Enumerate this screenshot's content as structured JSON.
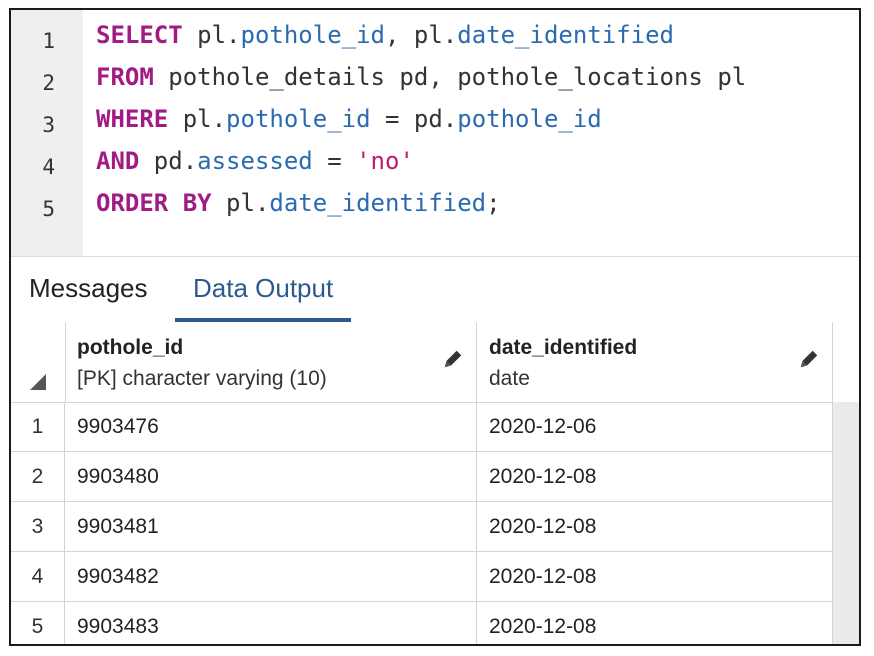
{
  "editor": {
    "line_numbers": [
      "1",
      "2",
      "3",
      "4",
      "5"
    ],
    "lines": [
      [
        "SELECT",
        " pl.",
        "pothole_id",
        ", pl.",
        "date_identified"
      ],
      [
        "FROM",
        " pothole_details pd, pothole_locations pl"
      ],
      [
        "WHERE",
        " pl.",
        "pothole_id",
        " = pd.",
        "pothole_id"
      ],
      [
        "AND",
        " pd.",
        "assessed",
        " = ",
        "'no'"
      ],
      [
        "ORDER BY",
        " pl.",
        "date_identified",
        ";"
      ]
    ]
  },
  "tabs": [
    {
      "label": "Messages",
      "active": false
    },
    {
      "label": "Data Output",
      "active": true
    }
  ],
  "grid": {
    "columns": [
      {
        "name": "pothole_id",
        "type": "[PK] character varying (10)"
      },
      {
        "name": "date_identified",
        "type": "date"
      }
    ],
    "rows": [
      {
        "num": "1",
        "cells": [
          "9903476",
          "2020-12-06"
        ]
      },
      {
        "num": "2",
        "cells": [
          "9903480",
          "2020-12-08"
        ]
      },
      {
        "num": "3",
        "cells": [
          "9903481",
          "2020-12-08"
        ]
      },
      {
        "num": "4",
        "cells": [
          "9903482",
          "2020-12-08"
        ]
      },
      {
        "num": "5",
        "cells": [
          "9903483",
          "2020-12-08"
        ]
      }
    ]
  },
  "colors": {
    "keyword": "#a01c84",
    "identifier": "#2c6ab0",
    "string": "#c41a6d",
    "active_tab": "#2c5a8e"
  },
  "icons": {
    "edit_column": "pencil-icon",
    "select_all": "select-all-triangle"
  }
}
